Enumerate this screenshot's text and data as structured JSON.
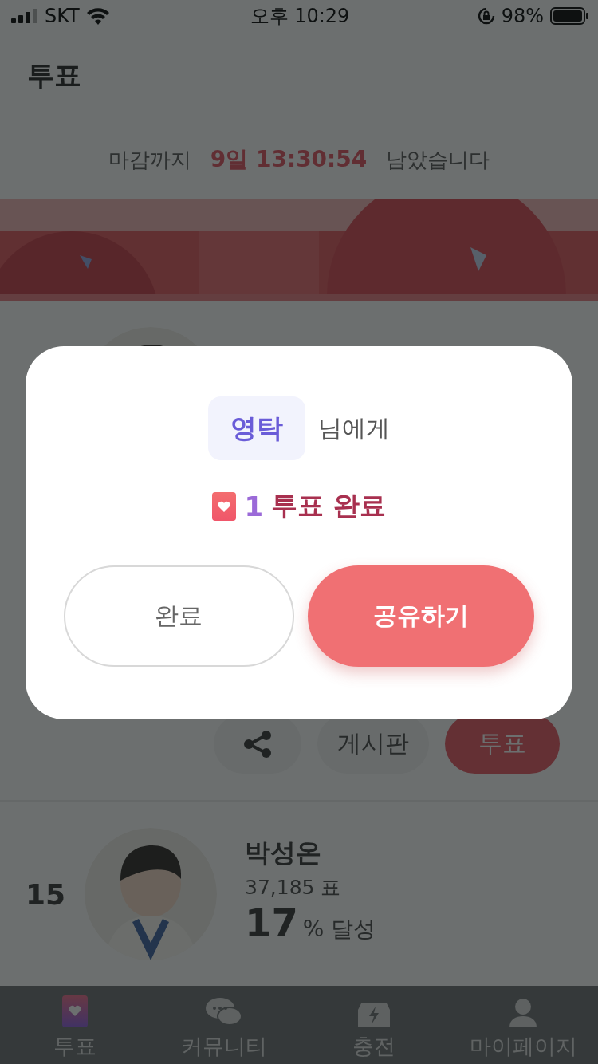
{
  "status_bar": {
    "carrier": "SKT",
    "time": "오후 10:29",
    "battery": "98%"
  },
  "header": {
    "title": "투표"
  },
  "countdown": {
    "prefix": "마감까지",
    "remaining": "9일 13:30:54",
    "suffix": "남았습니다"
  },
  "candidates": [
    {
      "actions": {
        "board": "게시판",
        "vote": "투표"
      }
    },
    {
      "rank": "15",
      "name": "박성온",
      "votes": "37,185 표",
      "percent": "17",
      "percent_label": "% 달성"
    }
  ],
  "tab_bar": [
    {
      "label": "투표",
      "selected": true
    },
    {
      "label": "커뮤니티",
      "selected": false
    },
    {
      "label": "충전",
      "selected": false
    },
    {
      "label": "마이페이지",
      "selected": false
    }
  ],
  "modal": {
    "recipient": "영탁",
    "recipient_suffix": "님에게",
    "result_count": "1",
    "result_label": "투표 완료",
    "buttons": [
      {
        "label": "완료",
        "kind": "secondary"
      },
      {
        "label": "공유하기",
        "kind": "primary"
      }
    ]
  }
}
